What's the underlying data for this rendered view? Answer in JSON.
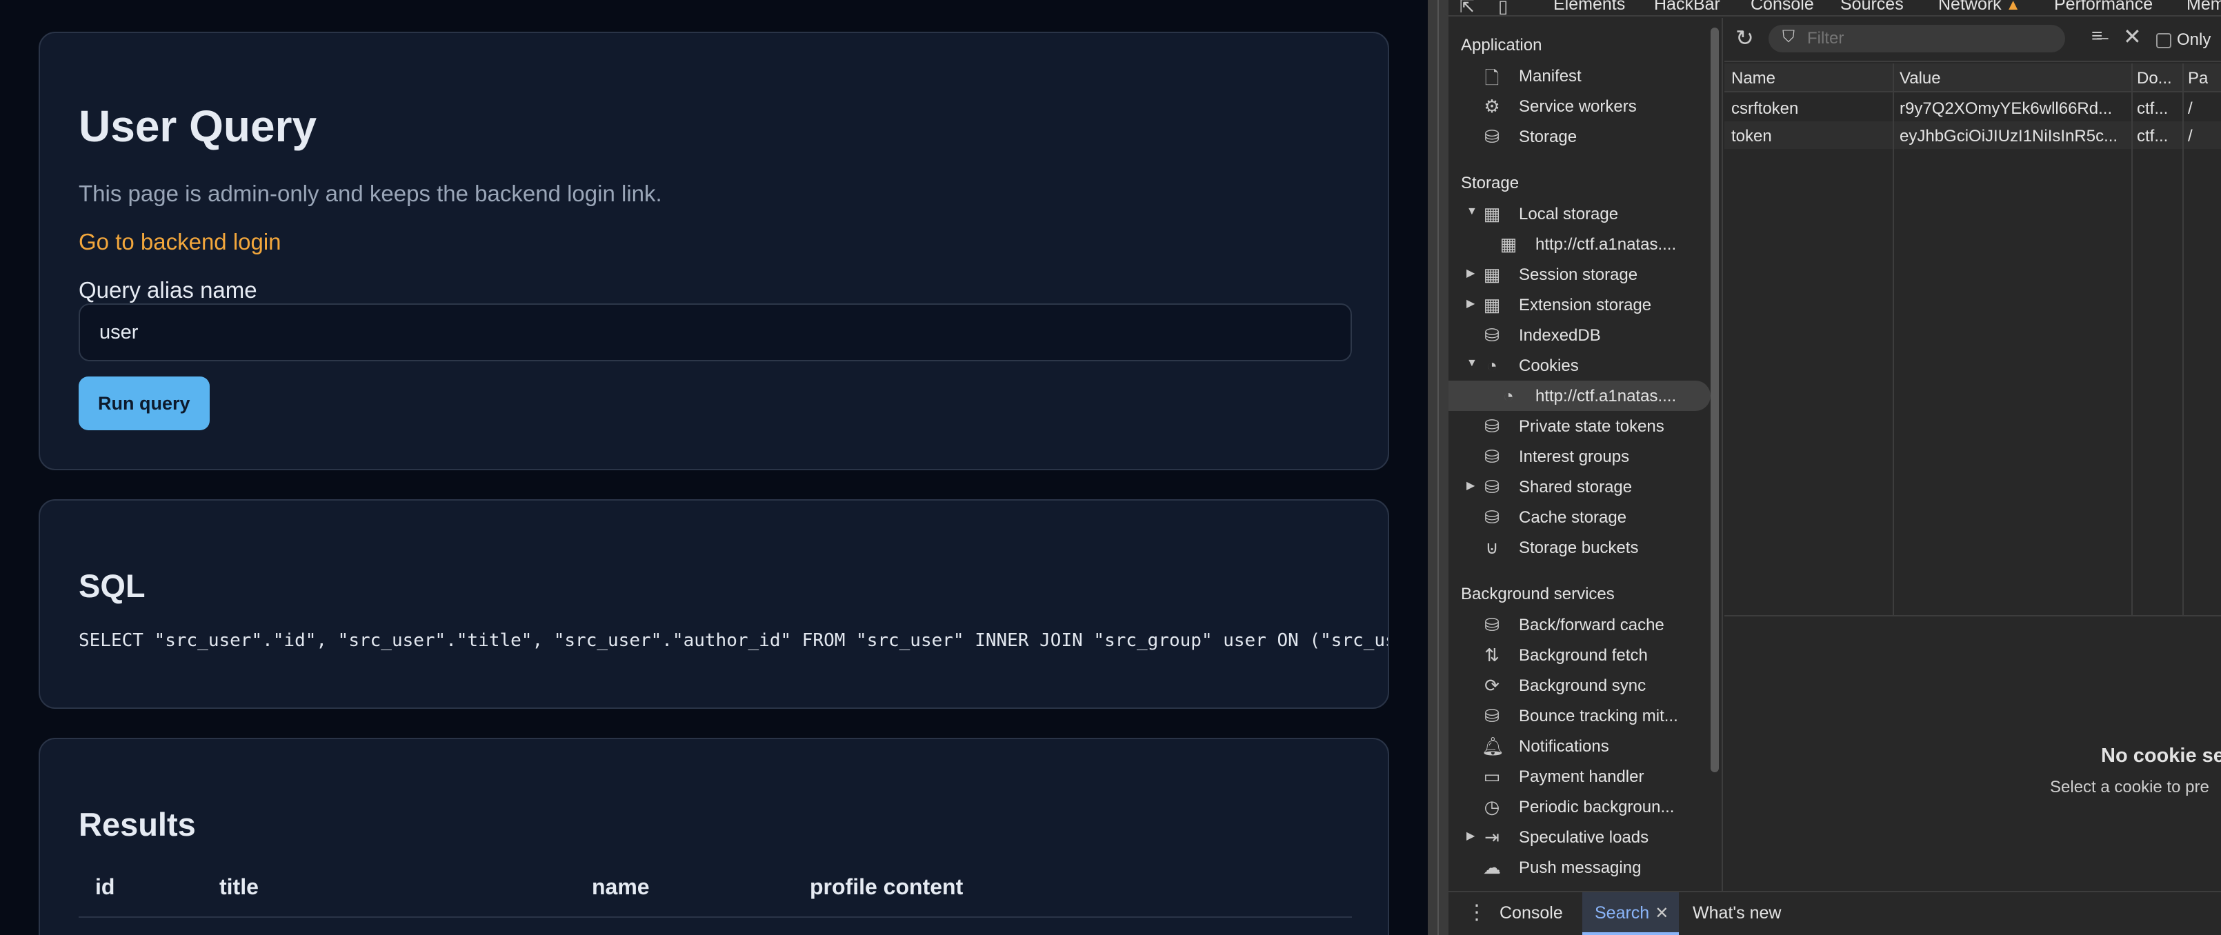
{
  "page": {
    "title": "User Query",
    "description": "This page is admin-only and keeps the backend login link.",
    "backend_link": "Go to backend login",
    "field_label": "Query alias name",
    "field_value": "user",
    "run_button": "Run query",
    "sql_title": "SQL",
    "sql_text": "SELECT \"src_user\".\"id\", \"src_user\".\"title\", \"src_user\".\"author_id\" FROM \"src_user\" INNER JOIN \"src_group\" user ON (\"src_user\"",
    "results_title": "Results",
    "results_columns": [
      "id",
      "title",
      "name",
      "profile content"
    ]
  },
  "devtools": {
    "top_tabs": [
      "Elements",
      "HackBar",
      "Console",
      "Sources",
      "Network",
      "Performance",
      "Mem"
    ],
    "sidebar": {
      "application_header": "Application",
      "application_items": [
        "Manifest",
        "Service workers",
        "Storage"
      ],
      "storage_header": "Storage",
      "storage_items": [
        "Local storage",
        "http://ctf.a1natas....",
        "Session storage",
        "Extension storage",
        "IndexedDB",
        "Cookies",
        "http://ctf.a1natas....",
        "Private state tokens",
        "Interest groups",
        "Shared storage",
        "Cache storage",
        "Storage buckets"
      ],
      "background_header": "Background services",
      "background_items": [
        "Back/forward cache",
        "Background fetch",
        "Background sync",
        "Bounce tracking mit...",
        "Notifications",
        "Payment handler",
        "Periodic backgroun...",
        "Speculative loads",
        "Push messaging"
      ]
    },
    "filter": {
      "placeholder": "Filter",
      "only_label": "Only"
    },
    "cookies": {
      "columns": [
        "Name",
        "Value",
        "Do...",
        "Pa"
      ],
      "rows": [
        [
          "csrftoken",
          "r9y7Q2XOmyYEk6wll66Rd...",
          "ctf...",
          "/"
        ],
        [
          "token",
          "eyJhbGciOiJIUzI1NiIsInR5c...",
          "ctf...",
          "/"
        ]
      ]
    },
    "preview": {
      "title": "No cookie sel",
      "subtitle": "Select a cookie to pre"
    },
    "drawer_tabs": [
      "Console",
      "Search",
      "What's new"
    ]
  }
}
